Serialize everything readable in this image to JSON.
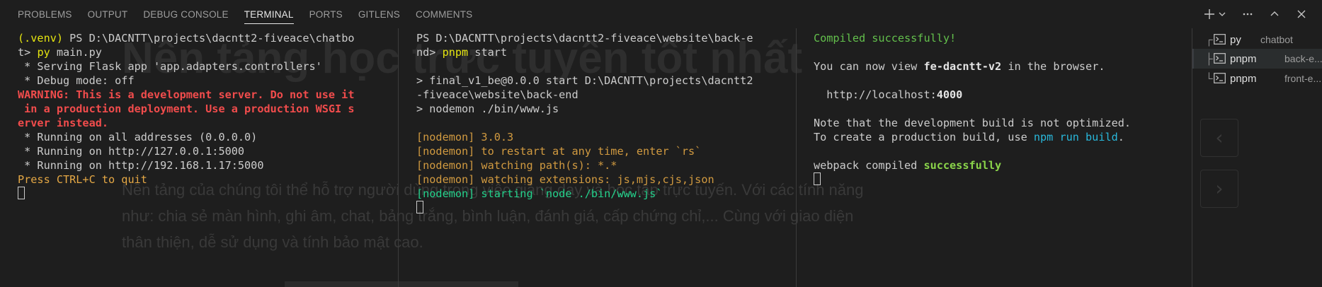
{
  "background": {
    "title": "Nền tảng học trực tuyến tốt nhất",
    "paragraph": "Nền tảng của chúng tôi thể hỗ trợ người dùng trong việc giảng dạy và học tập trực tuyến. Với các tính năng như: chia sẻ màn hình, ghi âm, chat, bảng trắng, bình luận, đánh giá, cấp chứng chỉ,... Cùng với giao diện thân thiện, dễ sử dụng và tính bảo mật cao."
  },
  "panel": {
    "tabs": [
      {
        "label": "PROBLEMS"
      },
      {
        "label": "OUTPUT"
      },
      {
        "label": "DEBUG CONSOLE"
      },
      {
        "label": "TERMINAL",
        "active": true
      },
      {
        "label": "PORTS"
      },
      {
        "label": "GITLENS"
      },
      {
        "label": "COMMENTS"
      }
    ],
    "actions": [
      "new-terminal-icon",
      "chevron-down-icon",
      "more-actions-icon",
      "maximize-panel-icon",
      "close-icon"
    ]
  },
  "terminals": [
    {
      "lines": [
        [
          {
            "t": "(.venv) ",
            "c": "yellow"
          },
          {
            "t": "PS D:\\DACNTT\\projects\\dacntt2-fiveace\\chatbo",
            "c": "default"
          }
        ],
        [
          {
            "t": "t> ",
            "c": "default"
          },
          {
            "t": "py",
            "c": "yellow"
          },
          {
            "t": " main.py",
            "c": "default"
          }
        ],
        [
          {
            "t": " * Serving Flask app 'app.adapters.controllers'",
            "c": "default"
          }
        ],
        [
          {
            "t": " * Debug mode: off",
            "c": "default"
          }
        ],
        [
          {
            "t": "WARNING: This is a development server. Do not use it",
            "c": "red"
          }
        ],
        [
          {
            "t": " in a production deployment. Use a production WSGI s",
            "c": "red"
          }
        ],
        [
          {
            "t": "erver instead.",
            "c": "red"
          }
        ],
        [
          {
            "t": " * Running on all addresses (0.0.0.0)",
            "c": "default"
          }
        ],
        [
          {
            "t": " * Running on http://127.0.0.1:5000",
            "c": "default"
          }
        ],
        [
          {
            "t": " * Running on http://192.168.1.17:5000",
            "c": "default"
          }
        ],
        [
          {
            "t": "Press CTRL+C to quit",
            "c": "orange"
          }
        ]
      ]
    },
    {
      "lines": [
        [
          {
            "t": "PS D:\\DACNTT\\projects\\dacntt2-fiveace\\website\\back-e",
            "c": "default"
          }
        ],
        [
          {
            "t": "nd> ",
            "c": "default"
          },
          {
            "t": "pnpm",
            "c": "yellow"
          },
          {
            "t": " start",
            "c": "default"
          }
        ],
        [
          {
            "t": "",
            "c": "default"
          }
        ],
        [
          {
            "t": "> final_v1_be@0.0.0 start D:\\DACNTT\\projects\\dacntt2",
            "c": "default"
          }
        ],
        [
          {
            "t": "-fiveace\\website\\back-end",
            "c": "default"
          }
        ],
        [
          {
            "t": "> nodemon ./bin/www.js",
            "c": "default"
          }
        ],
        [
          {
            "t": "",
            "c": "default"
          }
        ],
        [
          {
            "t": "[nodemon] 3.0.3",
            "c": "nodemon"
          }
        ],
        [
          {
            "t": "[nodemon] to restart at any time, enter `rs`",
            "c": "nodemon"
          }
        ],
        [
          {
            "t": "[nodemon] watching path(s): *.*",
            "c": "nodemon"
          }
        ],
        [
          {
            "t": "[nodemon] watching extensions: js,mjs,cjs,json",
            "c": "nodemon"
          }
        ],
        [
          {
            "t": "[nodemon] starting `node ./bin/www.js`",
            "c": "green"
          }
        ]
      ]
    },
    {
      "lines": [
        [
          {
            "t": "Compiled successfully!",
            "c": "compiled"
          }
        ],
        [
          {
            "t": "",
            "c": "default"
          }
        ],
        [
          {
            "t": "You can now view ",
            "c": "default"
          },
          {
            "t": "fe-dacntt-v2",
            "c": "bold"
          },
          {
            "t": " in the browser.",
            "c": "default"
          }
        ],
        [
          {
            "t": "",
            "c": "default"
          }
        ],
        [
          {
            "t": "  http://localhost:",
            "c": "default"
          },
          {
            "t": "4000",
            "c": "bold"
          }
        ],
        [
          {
            "t": "",
            "c": "default"
          }
        ],
        [
          {
            "t": "Note that the development build is not optimized.",
            "c": "default"
          }
        ],
        [
          {
            "t": "To create a production build, use ",
            "c": "default"
          },
          {
            "t": "npm run build",
            "c": "link"
          },
          {
            "t": ".",
            "c": "default"
          }
        ],
        [
          {
            "t": "",
            "c": "default"
          }
        ],
        [
          {
            "t": "webpack compiled ",
            "c": "default"
          },
          {
            "t": "successfully",
            "c": "greenbold"
          }
        ]
      ]
    }
  ],
  "terminal_list": [
    {
      "tree": "┌",
      "name": "py",
      "desc": "chatbot",
      "selected": false
    },
    {
      "tree": "├",
      "name": "pnpm",
      "desc": "back-e...",
      "selected": true
    },
    {
      "tree": "└",
      "name": "pnpm",
      "desc": "front-e...",
      "selected": false
    }
  ]
}
